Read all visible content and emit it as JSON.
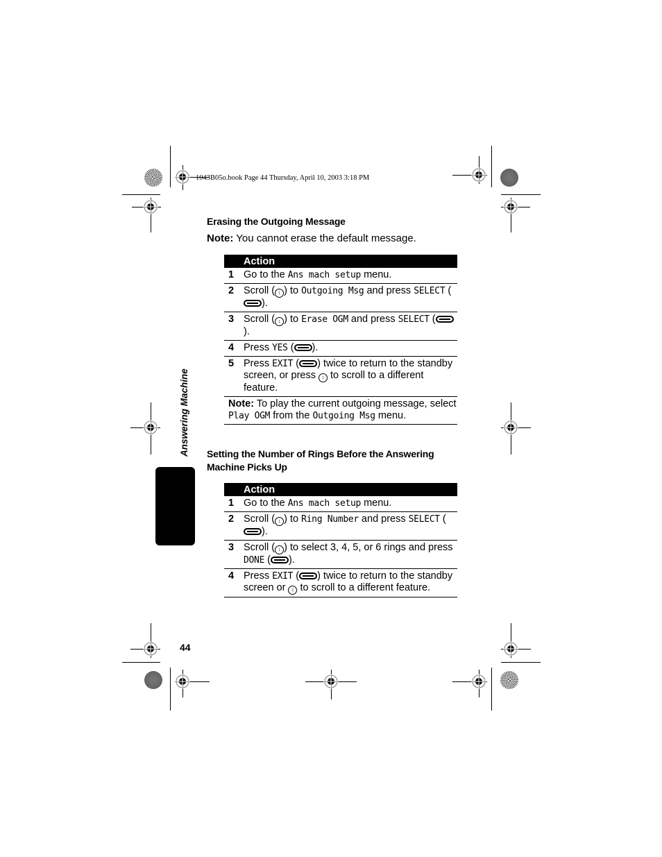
{
  "header_slug": "1043B05o.book  Page 44  Thursday, April 10, 2003  3:18 PM",
  "side_tab": {
    "label": "Answering Machine"
  },
  "page_number": "44",
  "icons": {
    "scroll": "scroll-key-icon",
    "softkey": "soft-key-icon"
  },
  "section1": {
    "title": "Erasing the Outgoing Message",
    "note_label": "Note:",
    "note_text": " You cannot erase the default message.",
    "table_header": "Action",
    "steps": [
      {
        "num": "1",
        "parts": [
          "Go to the ",
          "@Ans mach setup",
          " menu."
        ]
      },
      {
        "num": "2",
        "parts": [
          "Scroll (",
          "#scroll",
          ") to ",
          "@Outgoing Msg",
          " and press ",
          "@SELECT",
          " (",
          "#softkey",
          ")."
        ]
      },
      {
        "num": "3",
        "parts": [
          "Scroll (",
          "#scroll",
          ") to ",
          "@Erase OGM",
          " and press ",
          "@SELECT",
          " (",
          "#softkey",
          ")."
        ]
      },
      {
        "num": "4",
        "parts": [
          "Press ",
          "@YES",
          " (",
          "#softkey",
          ")."
        ]
      },
      {
        "num": "5",
        "parts": [
          "Press ",
          "@EXIT",
          " (",
          "#softkey",
          ") twice to return to the standby screen, or press ",
          "#scroll",
          " to scroll to a different feature."
        ]
      }
    ],
    "table_note": {
      "label": "Note:",
      "parts": [
        " To play the current outgoing message, select ",
        "@Play OGM",
        " from the ",
        "@Outgoing Msg",
        " menu."
      ]
    }
  },
  "section2": {
    "title": "Setting the Number of Rings Before the Answering Machine Picks Up",
    "table_header": "Action",
    "steps": [
      {
        "num": "1",
        "parts": [
          "Go to the ",
          "@Ans mach setup",
          " menu."
        ]
      },
      {
        "num": "2",
        "parts": [
          "Scroll (",
          "#scroll",
          ") to ",
          "@Ring Number",
          " and press ",
          "@SELECT",
          " (",
          "#softkey",
          ")."
        ]
      },
      {
        "num": "3",
        "parts": [
          "Scroll (",
          "#scroll",
          ") to select 3, 4, 5, or 6 rings and press ",
          "@DONE",
          " (",
          "#softkey",
          ")."
        ]
      },
      {
        "num": "4",
        "parts": [
          "Press ",
          "@EXIT",
          " (",
          "#softkey",
          ") twice to return to the standby screen or ",
          "#scroll",
          " to scroll to a different feature."
        ]
      }
    ]
  }
}
